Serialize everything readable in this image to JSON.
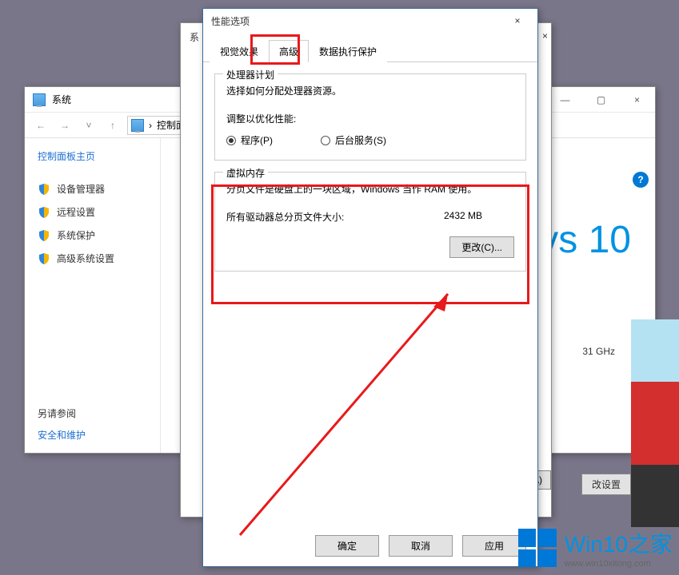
{
  "perf_dialog": {
    "title": "性能选项",
    "close_glyph": "×",
    "tabs": {
      "visual": "视觉效果",
      "advanced": "高级",
      "dep": "数据执行保护"
    },
    "processor": {
      "legend": "处理器计划",
      "desc": "选择如何分配处理器资源。",
      "adjust_label": "调整以优化性能:",
      "radio_programs": "程序(P)",
      "radio_services": "后台服务(S)"
    },
    "vmem": {
      "legend": "虚拟内存",
      "desc": "分页文件是硬盘上的一块区域，Windows 当作 RAM 使用。",
      "total_label": "所有驱动器总分页文件大小:",
      "total_value": "2432 MB",
      "change_btn": "更改(C)..."
    },
    "buttons": {
      "ok": "确定",
      "cancel": "取消",
      "apply": "应用"
    }
  },
  "mid_window": {
    "title_fragment": "系",
    "close_glyph": "×",
    "apply_btn": "A)"
  },
  "system_window": {
    "title": "系统",
    "breadcrumb": "控制面",
    "nav_sep": "›",
    "sidebar": {
      "title": "控制面板主页",
      "items": [
        "设备管理器",
        "远程设置",
        "系统保护",
        "高级系统设置"
      ],
      "see_also": "另请参阅",
      "security": "安全和维护"
    },
    "win_btns": {
      "min": "—",
      "max": "▢",
      "close": "×"
    },
    "right": {
      "windows10": "vs 10",
      "ghz": "31 GHz",
      "help": "?",
      "change_settings": "改设置"
    }
  },
  "watermark": {
    "name": "Win10之家",
    "url": "www.win10xitong.com"
  }
}
